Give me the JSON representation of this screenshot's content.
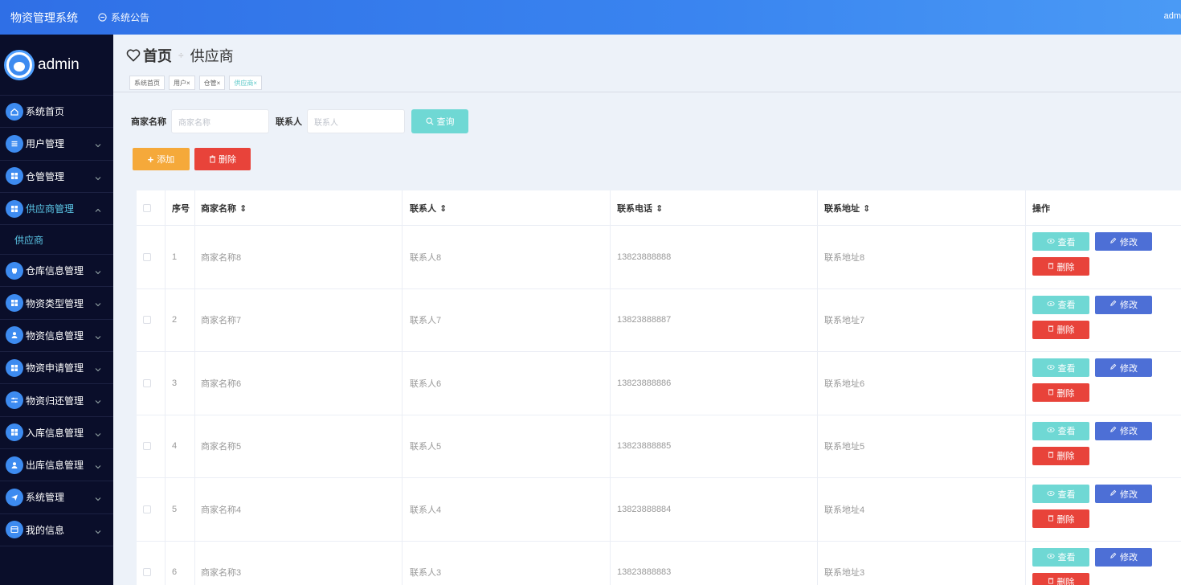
{
  "topbar": {
    "title": "物资管理系统",
    "notice": "系统公告",
    "user": "adm"
  },
  "sidebar": {
    "username": "admin",
    "items": [
      {
        "label": "系统首页",
        "icon": "home-icon"
      },
      {
        "label": "用户管理",
        "icon": "list-icon"
      },
      {
        "label": "仓管管理",
        "icon": "grid-icon"
      },
      {
        "label": "供应商管理",
        "icon": "grid-icon",
        "expanded": true,
        "children": [
          "供应商"
        ]
      },
      {
        "label": "仓库信息管理",
        "icon": "box-icon"
      },
      {
        "label": "物资类型管理",
        "icon": "grid-icon"
      },
      {
        "label": "物资信息管理",
        "icon": "user-icon"
      },
      {
        "label": "物资申请管理",
        "icon": "grid-icon"
      },
      {
        "label": "物资归还管理",
        "icon": "sliders-icon"
      },
      {
        "label": "入库信息管理",
        "icon": "grid-icon"
      },
      {
        "label": "出库信息管理",
        "icon": "user-icon"
      },
      {
        "label": "系统管理",
        "icon": "send-icon"
      },
      {
        "label": "我的信息",
        "icon": "card-icon"
      }
    ]
  },
  "breadcrumb": {
    "home": "首页",
    "current": "供应商"
  },
  "tabs": [
    "系统首页",
    "用户×",
    "仓管×",
    "供应商×"
  ],
  "search": {
    "name_label": "商家名称",
    "name_placeholder": "商家名称",
    "contact_label": "联系人",
    "contact_placeholder": "联系人",
    "query_label": "查询"
  },
  "actions": {
    "add_label": "添加",
    "delete_label": "删除"
  },
  "table": {
    "headers": {
      "index": "序号",
      "name": "商家名称",
      "contact": "联系人",
      "phone": "联系电话",
      "address": "联系地址",
      "ops": "操作"
    },
    "op_labels": {
      "view": "查看",
      "edit": "修改",
      "delete": "删除"
    },
    "rows": [
      {
        "index": "1",
        "name": "商家名称8",
        "contact": "联系人8",
        "phone": "13823888888",
        "address": "联系地址8"
      },
      {
        "index": "2",
        "name": "商家名称7",
        "contact": "联系人7",
        "phone": "13823888887",
        "address": "联系地址7"
      },
      {
        "index": "3",
        "name": "商家名称6",
        "contact": "联系人6",
        "phone": "13823888886",
        "address": "联系地址6"
      },
      {
        "index": "4",
        "name": "商家名称5",
        "contact": "联系人5",
        "phone": "13823888885",
        "address": "联系地址5"
      },
      {
        "index": "5",
        "name": "商家名称4",
        "contact": "联系人4",
        "phone": "13823888884",
        "address": "联系地址4"
      },
      {
        "index": "6",
        "name": "商家名称3",
        "contact": "联系人3",
        "phone": "13823888883",
        "address": "联系地址3"
      }
    ]
  },
  "colors": {
    "topbar": "#3a85f0",
    "sidebar": "#0a0e2a",
    "accent": "#5cc8e8",
    "view": "#6fd8d4",
    "edit": "#4d6fd6",
    "danger": "#e8433a",
    "add": "#f5a93a"
  }
}
